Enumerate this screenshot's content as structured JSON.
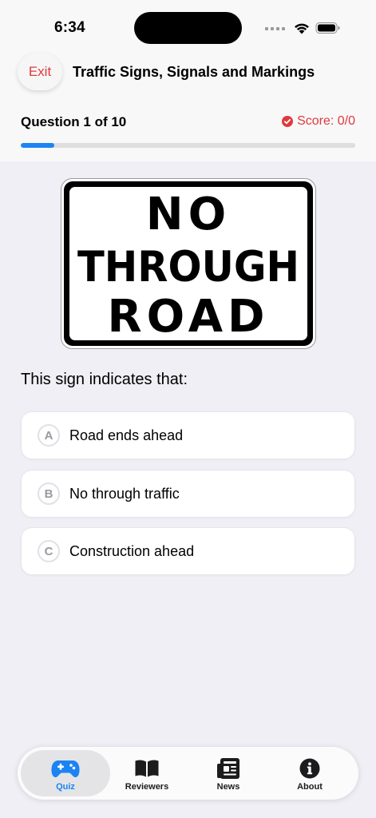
{
  "status_bar": {
    "time": "6:34"
  },
  "header": {
    "exit_label": "Exit",
    "title": "Traffic Signs, Signals and Markings"
  },
  "progress": {
    "question_label": "Question 1 of 10",
    "score_label": "Score: 0/0",
    "fraction": 0.1,
    "fill_color": "#1b84f2"
  },
  "sign": {
    "lines": [
      "NO",
      "THROUGH",
      "ROAD"
    ]
  },
  "question": {
    "prompt": "This sign indicates that:",
    "options": [
      {
        "letter": "A",
        "text": "Road ends ahead"
      },
      {
        "letter": "B",
        "text": "No through traffic"
      },
      {
        "letter": "C",
        "text": "Construction ahead"
      }
    ]
  },
  "tabbar": {
    "items": [
      {
        "label": "Quiz",
        "icon": "gamepad-icon",
        "active": true
      },
      {
        "label": "Reviewers",
        "icon": "book-icon",
        "active": false
      },
      {
        "label": "News",
        "icon": "newspaper-icon",
        "active": false
      },
      {
        "label": "About",
        "icon": "info-icon",
        "active": false
      }
    ]
  },
  "colors": {
    "accent": "#1b84f2",
    "danger": "#e0393e"
  }
}
